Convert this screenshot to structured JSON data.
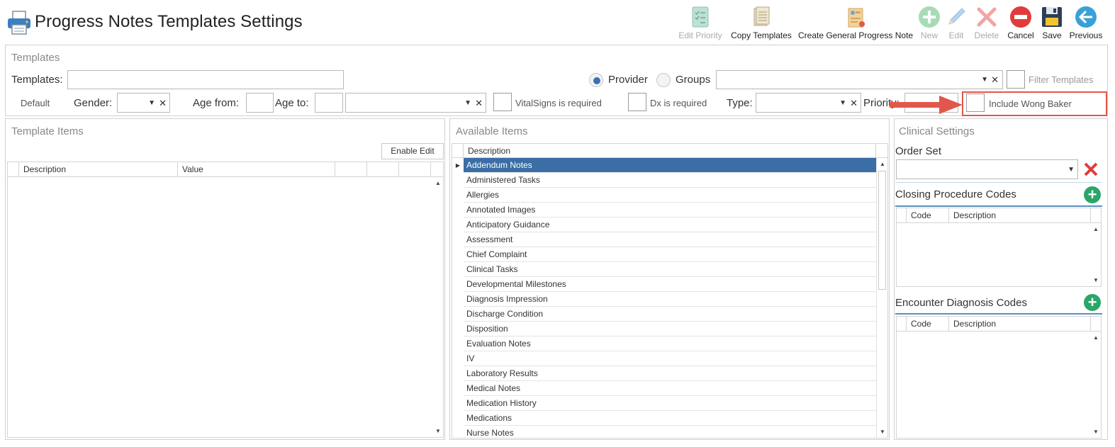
{
  "header": {
    "title": "Progress Notes Templates Settings"
  },
  "toolbar": {
    "edit_priority": "Edit Priority",
    "copy_templates": "Copy Templates",
    "create_general": "Create General Progress Note",
    "new": "New",
    "edit": "Edit",
    "delete": "Delete",
    "cancel": "Cancel",
    "save": "Save",
    "previous": "Previous"
  },
  "templates_panel": {
    "section_title": "Templates",
    "templates_label": "Templates:",
    "provider_label": "Provider",
    "groups_label": "Groups",
    "filter_templates_label": "Filter Templates",
    "default_label": "Default",
    "gender_label": "Gender:",
    "age_from_label": "Age from:",
    "age_to_label": "Age to:",
    "vitalsigns_label": "VitalSigns is required",
    "dx_label": "Dx is required",
    "type_label": "Type:",
    "priority_label": "Priority:",
    "wong_baker_label": "Include Wong Baker"
  },
  "template_items": {
    "section_title": "Template Items",
    "enable_edit": "Enable Edit",
    "columns": [
      "Description",
      "Value"
    ]
  },
  "available_items": {
    "section_title": "Available Items",
    "column": "Description",
    "rows": [
      "Addendum Notes",
      "Administered Tasks",
      "Allergies",
      "Annotated Images",
      "Anticipatory Guidance",
      "Assessment",
      "Chief Complaint",
      "Clinical Tasks",
      "Developmental Milestones",
      "Diagnosis Impression",
      "Discharge Condition",
      "Disposition",
      "Evaluation Notes",
      "IV",
      "Laboratory Results",
      "Medical Notes",
      "Medication History",
      "Medications",
      "Nurse Notes"
    ]
  },
  "clinical_settings": {
    "section_title": "Clinical Settings",
    "order_set_label": "Order Set",
    "closing_codes_label": "Closing Procedure Codes",
    "encounter_codes_label": "Encounter Diagnosis Codes",
    "code_col": "Code",
    "desc_col": "Description"
  },
  "colors": {
    "selection": "#3a6ea5",
    "annotation": "#e2574c",
    "add_green": "#2aa66a"
  }
}
